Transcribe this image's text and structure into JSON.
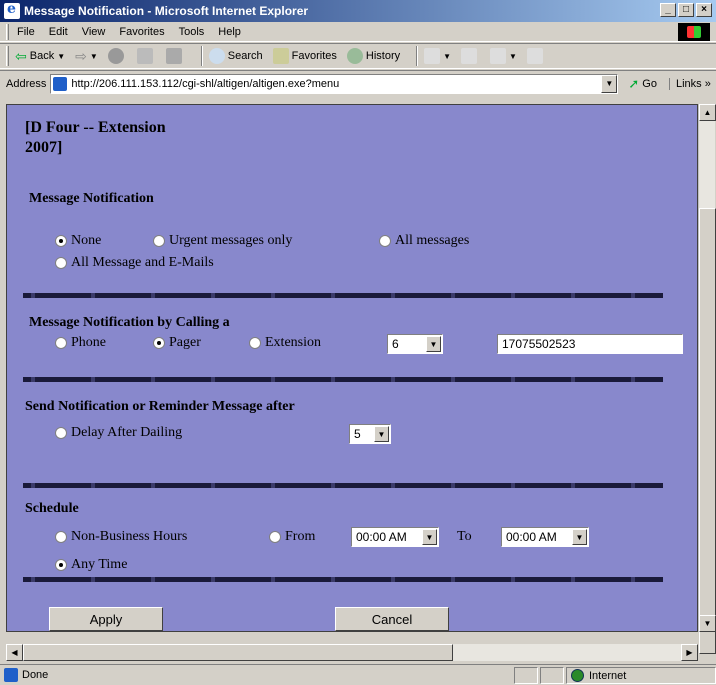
{
  "window": {
    "title": "Message Notification - Microsoft Internet Explorer",
    "buttons": {
      "minimize": "_",
      "maximize": "□",
      "close": "×"
    }
  },
  "menubar": {
    "items": [
      "File",
      "Edit",
      "View",
      "Favorites",
      "Tools",
      "Help"
    ]
  },
  "toolbar": {
    "back": "Back",
    "search": "Search",
    "favorites": "Favorites",
    "history": "History"
  },
  "address": {
    "label": "Address",
    "url": "http://206.111.153.112/cgi-shl/altigen/altigen.exe?menu",
    "go": "Go",
    "links": "Links »"
  },
  "page": {
    "heading_line1": "[D Four -- Extension",
    "heading_line2": "2007]",
    "notification": {
      "title": "Message Notification",
      "options": [
        {
          "label": "None",
          "selected": true
        },
        {
          "label": "Urgent messages only",
          "selected": false
        },
        {
          "label": "All messages",
          "selected": false
        },
        {
          "label": "All Message and E-Mails",
          "selected": false
        }
      ]
    },
    "calling": {
      "title": "Message Notification by Calling a",
      "options": [
        {
          "label": "Phone",
          "selected": false
        },
        {
          "label": "Pager",
          "selected": true
        },
        {
          "label": "Extension",
          "selected": false
        }
      ],
      "select_value": "6",
      "number_value": "17075502523"
    },
    "delay": {
      "title": "Send Notification or Reminder Message after",
      "option": {
        "label": "Delay After Dailing",
        "selected": false
      },
      "select_value": "5"
    },
    "schedule": {
      "title": "Schedule",
      "non_business": {
        "label": "Non-Business Hours",
        "selected": false
      },
      "from": {
        "label": "From",
        "selected": false
      },
      "from_value": "00:00 AM",
      "to_label": "To",
      "to_value": "00:00 AM",
      "any_time": {
        "label": "Any Time",
        "selected": true
      }
    },
    "buttons": {
      "apply": "Apply",
      "cancel": "Cancel"
    }
  },
  "status": {
    "text": "Done",
    "zone": "Internet"
  }
}
